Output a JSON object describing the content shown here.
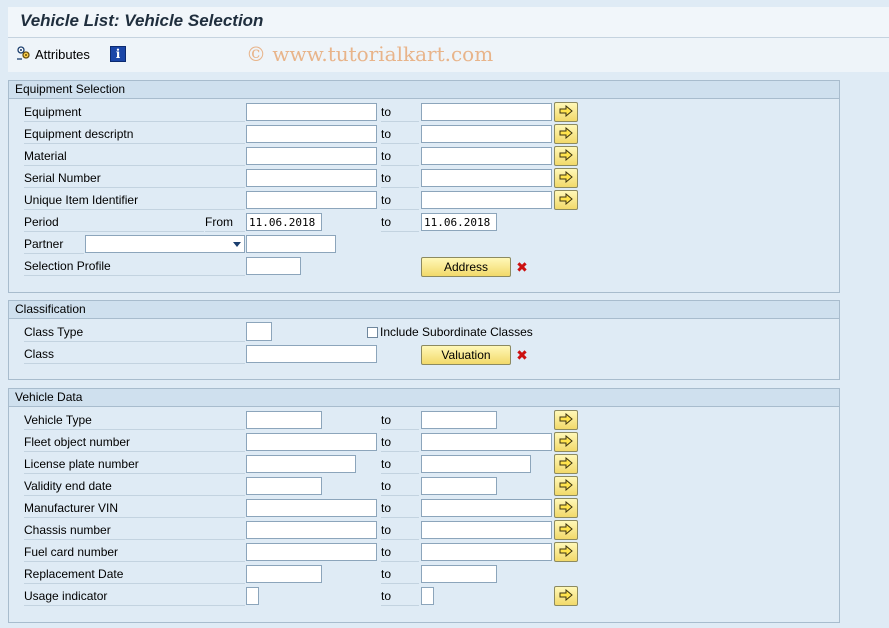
{
  "window": {
    "title": "Vehicle List: Vehicle Selection",
    "watermark": "© www.tutorialkart.com"
  },
  "toolbar": {
    "attributes_label": "Attributes"
  },
  "equipment_selection": {
    "title": "Equipment Selection",
    "to_label": "to",
    "from_label": "From",
    "rows": {
      "equipment": "Equipment",
      "equipment_descriptn": "Equipment descriptn",
      "material": "Material",
      "serial_number": "Serial Number",
      "unique_item_identifier": "Unique Item Identifier",
      "period": "Period",
      "partner": "Partner",
      "selection_profile": "Selection Profile"
    },
    "period_from": "11.06.2018",
    "period_to": "11.06.2018",
    "address_button": "Address"
  },
  "classification": {
    "title": "Classification",
    "class_type": "Class Type",
    "class": "Class",
    "include_subordinate": "Include Subordinate Classes",
    "valuation_button": "Valuation"
  },
  "vehicle_data": {
    "title": "Vehicle Data",
    "to_label": "to",
    "rows": {
      "vehicle_type": "Vehicle Type",
      "fleet_object_number": "Fleet object number",
      "license_plate_number": "License plate number",
      "validity_end_date": "Validity end date",
      "manufacturer_vin": "Manufacturer VIN",
      "chassis_number": "Chassis number",
      "fuel_card_number": "Fuel card number",
      "replacement_date": "Replacement Date",
      "usage_indicator": "Usage indicator"
    }
  }
}
